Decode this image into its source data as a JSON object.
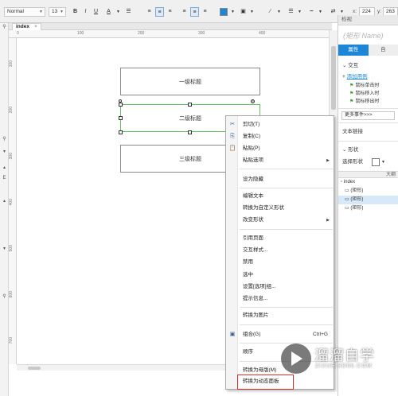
{
  "toolbar": {
    "font_family": "Normal",
    "font_size": "13",
    "bold": "B",
    "italic": "I",
    "underline": "U",
    "font_color": "A",
    "x_label": "x:",
    "x_value": "224",
    "y_label": "y:",
    "y_value": "263",
    "fill_color": "#1d86d7"
  },
  "tab": {
    "label": "index",
    "close": "×"
  },
  "ruler": {
    "h_ticks": [
      "0",
      "100",
      "200",
      "300",
      "400"
    ],
    "v_ticks": [
      "100",
      "200",
      "300",
      "400",
      "500",
      "600",
      "700"
    ]
  },
  "canvas": {
    "shape1": "一级标题",
    "shape2": "二级标题",
    "shape3": "三级标题"
  },
  "inspector": {
    "header": "检视",
    "name_placeholder": "(矩形 Name)",
    "tab_properties": "属性",
    "tab_other": "自",
    "section_interaction": "交互",
    "add_case": "添加用例",
    "events": [
      "鼠标单击时",
      "鼠标移入时",
      "鼠标移出时"
    ],
    "more_events": "更多事件>>>",
    "text_link": "文本链接",
    "section_shape": "形状",
    "select_shape": "选择形状",
    "outline_header": "大纲",
    "outline_root": "index",
    "outline_items": [
      "(矩形)",
      "(矩形)",
      "(矩形)"
    ]
  },
  "context_menu": {
    "cut": "剪切(T)",
    "copy": "复制(C)",
    "paste": "粘贴(P)",
    "paste_options": "粘贴选项",
    "set_hidden": "设为隐藏",
    "edit_text": "编辑文本",
    "convert_custom_shape": "转换为自定义形状",
    "change_shape": "改变形状",
    "reference_page": "引用页面",
    "interaction_styles": "交互样式...",
    "disabled": "禁用",
    "selected": "选中",
    "set_option_group": "设置[选项]组...",
    "tooltip": "提示信息...",
    "convert_image": "转换为图片",
    "group": "组合(G)",
    "group_shortcut": "Ctrl+G",
    "order": "顺序",
    "convert_master": "转换为母版(M)",
    "convert_dynamic_panel": "转换为动态面板"
  },
  "watermark": {
    "cn": "溜溜自学",
    "en": "ZIXUE.3D66.COM"
  }
}
